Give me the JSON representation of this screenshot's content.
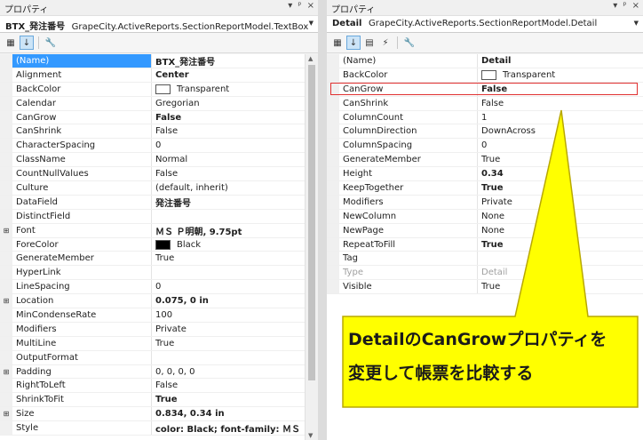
{
  "left": {
    "title": "プロパティ",
    "title_icons": [
      "▾",
      "ᵖ",
      "×"
    ],
    "selector": {
      "name": "BTX_発注番号",
      "type": "GrapeCity.ActiveReports.SectionReportModel.TextBox"
    },
    "properties": [
      {
        "expand": "",
        "name": "(Name)",
        "value": "BTX_発注番号",
        "bold": true,
        "selected": true
      },
      {
        "expand": "",
        "name": "Alignment",
        "value": "Center",
        "bold": true
      },
      {
        "expand": "",
        "name": "BackColor",
        "value": "Transparent",
        "swatch": "white"
      },
      {
        "expand": "",
        "name": "Calendar",
        "value": "Gregorian"
      },
      {
        "expand": "",
        "name": "CanGrow",
        "value": "False",
        "bold": true
      },
      {
        "expand": "",
        "name": "CanShrink",
        "value": "False"
      },
      {
        "expand": "",
        "name": "CharacterSpacing",
        "value": "0"
      },
      {
        "expand": "",
        "name": "ClassName",
        "value": "Normal"
      },
      {
        "expand": "",
        "name": "CountNullValues",
        "value": "False"
      },
      {
        "expand": "",
        "name": "Culture",
        "value": "(default, inherit)"
      },
      {
        "expand": "",
        "name": "DataField",
        "value": "発注番号",
        "bold": true
      },
      {
        "expand": "",
        "name": "DistinctField",
        "value": ""
      },
      {
        "expand": "⊞",
        "name": "Font",
        "value": "ＭＳ Ｐ明朝, 9.75pt",
        "bold": true
      },
      {
        "expand": "",
        "name": "ForeColor",
        "value": "Black",
        "swatch": "black"
      },
      {
        "expand": "",
        "name": "GenerateMember",
        "value": "True"
      },
      {
        "expand": "",
        "name": "HyperLink",
        "value": ""
      },
      {
        "expand": "",
        "name": "LineSpacing",
        "value": "0"
      },
      {
        "expand": "⊞",
        "name": "Location",
        "value": "0.075, 0 in",
        "bold": true
      },
      {
        "expand": "",
        "name": "MinCondenseRate",
        "value": "100"
      },
      {
        "expand": "",
        "name": "Modifiers",
        "value": "Private"
      },
      {
        "expand": "",
        "name": "MultiLine",
        "value": "True"
      },
      {
        "expand": "",
        "name": "OutputFormat",
        "value": ""
      },
      {
        "expand": "⊞",
        "name": "Padding",
        "value": "0, 0, 0, 0"
      },
      {
        "expand": "",
        "name": "RightToLeft",
        "value": "False"
      },
      {
        "expand": "",
        "name": "ShrinkToFit",
        "value": "True",
        "bold": true
      },
      {
        "expand": "⊞",
        "name": "Size",
        "value": "0.834, 0.34 in",
        "bold": true
      },
      {
        "expand": "",
        "name": "Style",
        "value": "color: Black; font-family: ＭＳ Ｐ明朝",
        "bold": true
      }
    ]
  },
  "right": {
    "title": "プロパティ",
    "title_icons": [
      "▾",
      "ᵖ",
      "×"
    ],
    "selector": {
      "name": "Detail",
      "type": "GrapeCity.ActiveReports.SectionReportModel.Detail"
    },
    "properties": [
      {
        "expand": "",
        "name": "(Name)",
        "value": "Detail",
        "bold": true
      },
      {
        "expand": "",
        "name": "BackColor",
        "value": "Transparent",
        "swatch": "white"
      },
      {
        "expand": "",
        "name": "CanGrow",
        "value": "False",
        "bold": true
      },
      {
        "expand": "",
        "name": "CanShrink",
        "value": "False"
      },
      {
        "expand": "",
        "name": "ColumnCount",
        "value": "1"
      },
      {
        "expand": "",
        "name": "ColumnDirection",
        "value": "DownAcross"
      },
      {
        "expand": "",
        "name": "ColumnSpacing",
        "value": "0"
      },
      {
        "expand": "",
        "name": "GenerateMember",
        "value": "True"
      },
      {
        "expand": "",
        "name": "Height",
        "value": "0.34",
        "bold": true
      },
      {
        "expand": "",
        "name": "KeepTogether",
        "value": "True",
        "bold": true
      },
      {
        "expand": "",
        "name": "Modifiers",
        "value": "Private"
      },
      {
        "expand": "",
        "name": "NewColumn",
        "value": "None"
      },
      {
        "expand": "",
        "name": "NewPage",
        "value": "None"
      },
      {
        "expand": "",
        "name": "RepeatToFill",
        "value": "True",
        "bold": true
      },
      {
        "expand": "",
        "name": "Tag",
        "value": ""
      },
      {
        "expand": "",
        "name": "Type",
        "value": "Detail",
        "disabled": true
      },
      {
        "expand": "",
        "name": "Visible",
        "value": "True"
      }
    ]
  },
  "callout": {
    "line1": "DetailのCanGrowプロパティを",
    "line2": "変更して帳票を比較する",
    "fill": "#ffff00",
    "stroke": "#b8a800"
  },
  "colors": {
    "selection": "#3399ff",
    "highlight_border": "#e03030"
  }
}
